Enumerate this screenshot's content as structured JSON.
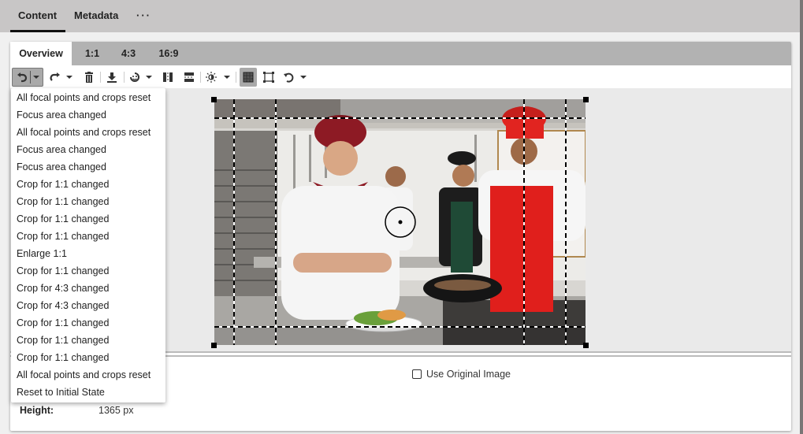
{
  "top_tabs": [
    {
      "label": "Content",
      "active": true
    },
    {
      "label": "Metadata",
      "active": false
    },
    {
      "label": "···",
      "active": false
    }
  ],
  "sub_tabs": [
    {
      "label": "Overview",
      "active": true
    },
    {
      "label": "1:1",
      "active": false
    },
    {
      "label": "4:3",
      "active": false
    },
    {
      "label": "16:9",
      "active": false
    }
  ],
  "toolbar": {
    "buttons": [
      {
        "icon": "undo-icon",
        "has_dropdown": true,
        "pressed": true
      },
      {
        "icon": "redo-icon",
        "has_dropdown": true
      },
      {
        "icon": "trash-icon"
      },
      {
        "icon": "download-icon"
      },
      {
        "icon": "focal-point-icon",
        "has_dropdown": true
      },
      {
        "icon": "vertical-crop-icon"
      },
      {
        "icon": "horizontal-crop-icon"
      },
      {
        "icon": "brightness-icon",
        "has_dropdown": true
      },
      {
        "icon": "grid-overlay-icon",
        "pressed": true
      },
      {
        "icon": "crop-frame-icon"
      },
      {
        "icon": "rotate-icon",
        "has_dropdown": true
      }
    ]
  },
  "history_menu": {
    "items": [
      "All focal points and crops reset",
      "Focus area changed",
      "All focal points and crops reset",
      "Focus area changed",
      "Focus area changed",
      "Crop for 1:1 changed",
      "Crop for 1:1 changed",
      "Crop for 1:1 changed",
      "Crop for 1:1 changed",
      "Enlarge 1:1",
      "Crop for 1:1 changed",
      "Crop for 4:3 changed",
      "Crop for 4:3 changed",
      "Crop for 1:1 changed",
      "Crop for 1:1 changed",
      "Crop for 1:1 changed",
      "All focal points and crops reset",
      "Reset to Initial State"
    ]
  },
  "image": {
    "alt": "Chefs in a commercial kitchen"
  },
  "options": {
    "use_original_image_label": "Use Original Image",
    "use_original_image_checked": false
  },
  "info": {
    "height_label": "Height:",
    "height_value": "1365 px"
  },
  "colors": {
    "top_bar": "#c8c6c6",
    "sub_tab_bar": "#b2b2b2",
    "canvas_bg": "#eaeaea",
    "pressed_button": "#a9a9a9"
  }
}
